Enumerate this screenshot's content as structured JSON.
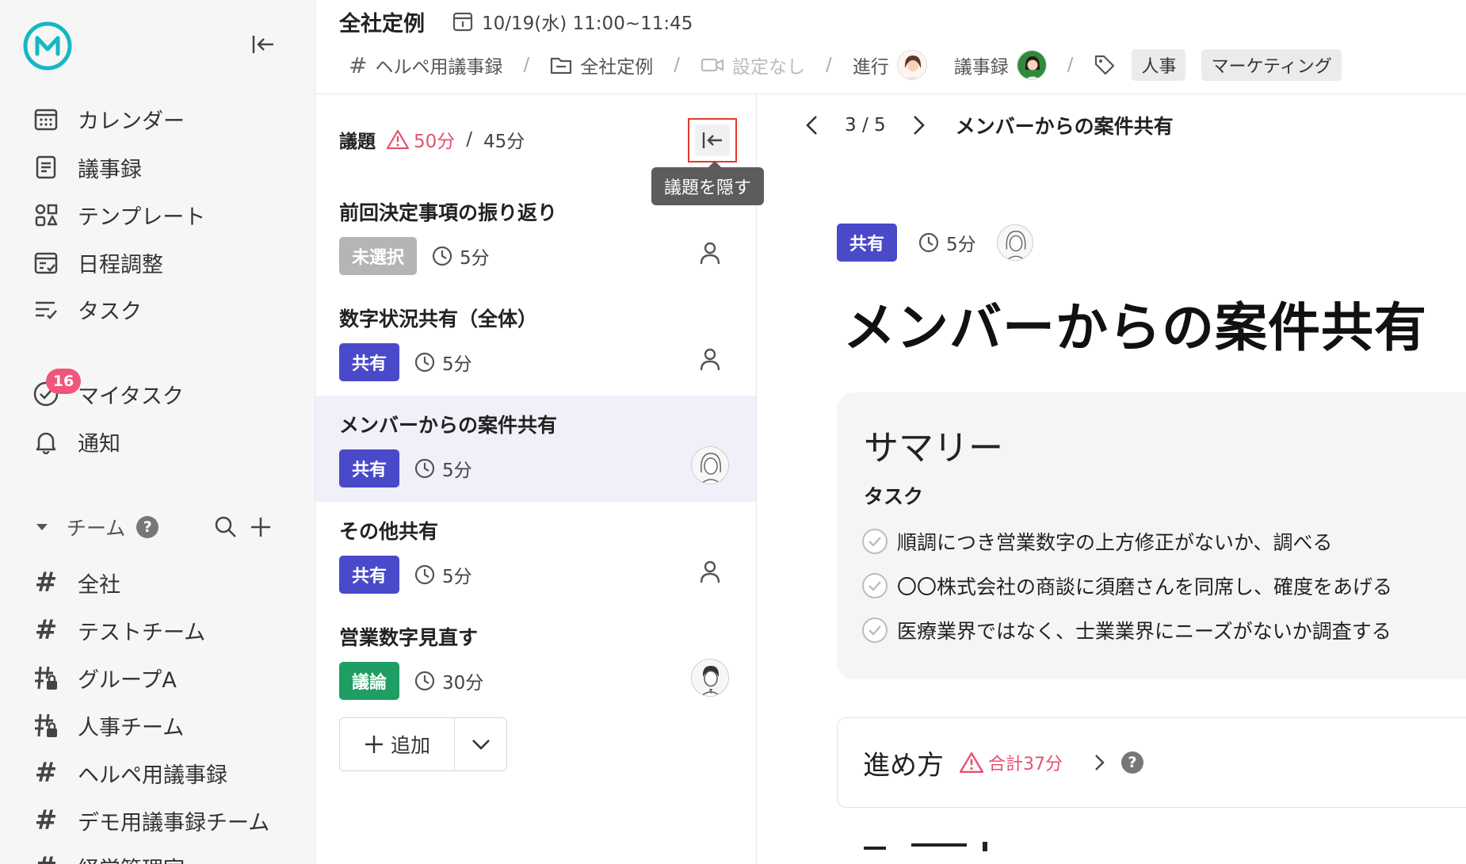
{
  "sidebar": {
    "nav": [
      {
        "label": "カレンダー",
        "icon": "calendar-icon"
      },
      {
        "label": "議事録",
        "icon": "document-icon"
      },
      {
        "label": "テンプレート",
        "icon": "template-icon"
      },
      {
        "label": "日程調整",
        "icon": "schedule-icon"
      },
      {
        "label": "タスク",
        "icon": "task-list-icon"
      }
    ],
    "my_task": {
      "label": "マイタスク",
      "badge": "16"
    },
    "notification": {
      "label": "通知"
    },
    "team_section": {
      "label": "チーム",
      "help": "?"
    },
    "teams": [
      {
        "label": "全社",
        "icon": "hash-icon"
      },
      {
        "label": "テストチーム",
        "icon": "hash-icon"
      },
      {
        "label": "グループA",
        "icon": "locked-hash-icon"
      },
      {
        "label": "人事チーム",
        "icon": "locked-hash-icon"
      },
      {
        "label": "ヘルペ用議事録",
        "icon": "hash-icon"
      },
      {
        "label": "デモ用議事録チーム",
        "icon": "hash-icon"
      },
      {
        "label": "経営管理室",
        "icon": "hash-icon"
      }
    ]
  },
  "header": {
    "title": "全社定例",
    "datetime": "10/19(水) 11:00~11:45",
    "channel": "ヘルペ用議事録",
    "folder": "全社定例",
    "video": "設定なし",
    "facilitator_label": "進行",
    "minutes_label": "議事録",
    "tags": [
      "人事",
      "マーケティング"
    ]
  },
  "agenda": {
    "label": "議題",
    "total": "50分",
    "separator": "/",
    "planned": "45分",
    "tooltip": "議題を隠す",
    "items": [
      {
        "title": "前回決定事項の振り返り",
        "type": "未選択",
        "type_color": "gray",
        "duration": "5分",
        "assignee": "none"
      },
      {
        "title": "数字状況共有（全体）",
        "type": "共有",
        "type_color": "blue",
        "duration": "5分",
        "assignee": "none"
      },
      {
        "title": "メンバーからの案件共有",
        "type": "共有",
        "type_color": "blue",
        "duration": "5分",
        "assignee": "woman",
        "active": true
      },
      {
        "title": "その他共有",
        "type": "共有",
        "type_color": "blue",
        "duration": "5分",
        "assignee": "none"
      },
      {
        "title": "営業数字見直す",
        "type": "議論",
        "type_color": "green",
        "duration": "30分",
        "assignee": "man"
      }
    ],
    "add_label": "追加"
  },
  "detail": {
    "position": "3 / 5",
    "nav_title": "メンバーからの案件共有",
    "type": "共有",
    "duration": "5分",
    "title": "メンバーからの案件共有",
    "summary": {
      "heading": "サマリー",
      "task_heading": "タスク",
      "tasks": [
        "順調につき営業数字の上方修正がないか、調べる",
        "〇〇株式会社の商談に須磨さんを同席し、確度をあげる",
        "医療業界ではなく、士業業界にニーズがないか調査する"
      ]
    },
    "process": {
      "heading": "進め方",
      "warning": "合計37分"
    }
  },
  "colors": {
    "accent_blue": "#4949c9",
    "green": "#1f9e63",
    "warning": "#e5516f",
    "logo": "#14b8c4",
    "highlight_box": "#e23a2a"
  }
}
